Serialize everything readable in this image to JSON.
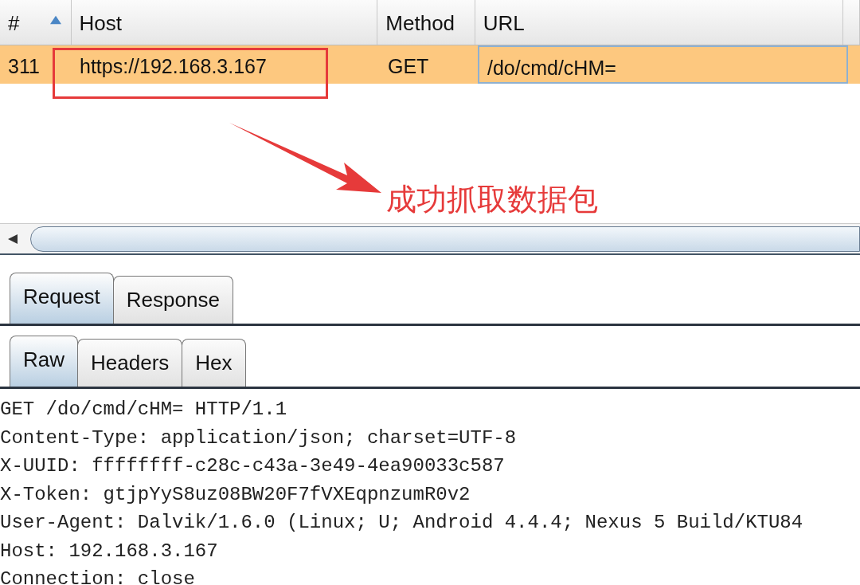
{
  "table": {
    "columns": [
      {
        "label": "#",
        "sorted": true
      },
      {
        "label": "Host",
        "sorted": false
      },
      {
        "label": "Method",
        "sorted": false
      },
      {
        "label": "URL",
        "sorted": false
      }
    ],
    "rows": [
      {
        "cells": [
          "311",
          "https://192.168.3.167",
          "GET",
          "/do/cmd/cHM="
        ],
        "selected": true
      }
    ]
  },
  "annotation": {
    "text": "成功抓取数据包"
  },
  "message_tabs": [
    {
      "label": "Request",
      "selected": true
    },
    {
      "label": "Response",
      "selected": false
    }
  ],
  "view_tabs": [
    {
      "label": "Raw",
      "selected": true
    },
    {
      "label": "Headers",
      "selected": false
    },
    {
      "label": "Hex",
      "selected": false
    }
  ],
  "raw_lines": [
    "GET /do/cmd/cHM= HTTP/1.1",
    "Content-Type: application/json; charset=UTF-8",
    "X-UUID: ffffffff-c28c-c43a-3e49-4ea90033c587",
    "X-Token: gtjpYyS8uz08BW20F7fVXEqpnzumR0v2",
    "User-Agent: Dalvik/1.6.0 (Linux; U; Android 4.4.4; Nexus 5 Build/KTU84",
    "Host: 192.168.3.167",
    "Connection: close"
  ]
}
